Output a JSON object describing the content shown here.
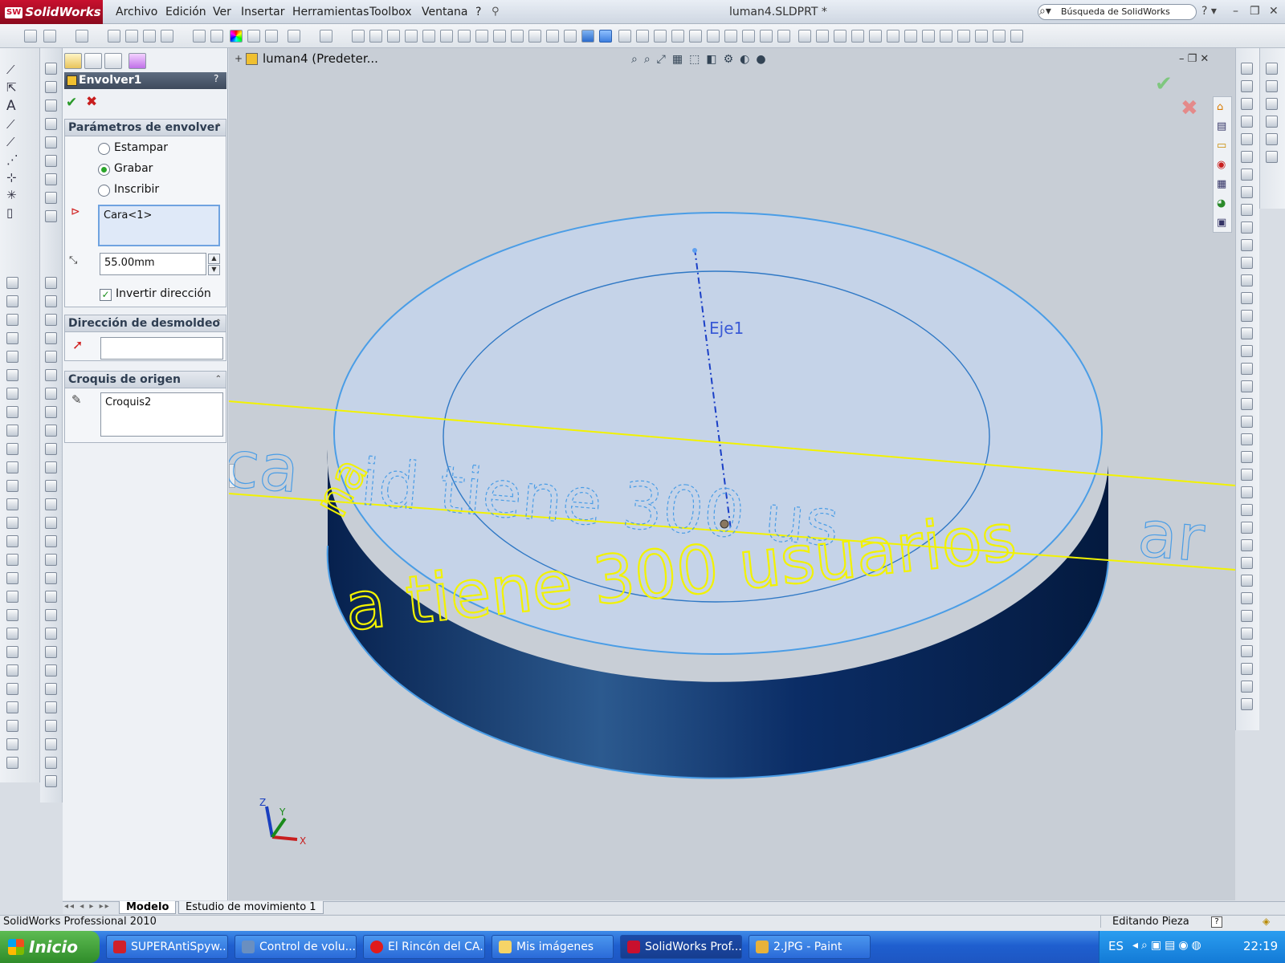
{
  "app": {
    "name": "SolidWorks",
    "logo_text": "SW"
  },
  "menu": [
    "Archivo",
    "Edición",
    "Ver",
    "Insertar",
    "Herramientas",
    "Toolbox",
    "Ventana",
    "?"
  ],
  "window": {
    "title": "luman4.SLDPRT *",
    "search_placeholder": "Búsqueda de SolidWorks"
  },
  "tree": {
    "label": "luman4  (Predeter..."
  },
  "property_manager": {
    "title": "Envolver1",
    "help": "?",
    "groups": {
      "params": {
        "title": "Parámetros de envolver",
        "options": [
          "Estampar",
          "Grabar",
          "Inscribir"
        ],
        "selected": "Grabar",
        "face": "Cara<1>",
        "depth": "55.00mm",
        "invert_label": "Invertir dirección",
        "invert_checked": true
      },
      "pull": {
        "title": "Dirección de desmoldeo",
        "value": ""
      },
      "source": {
        "title": "Croquis de origen",
        "value": "Croquis2"
      }
    }
  },
  "viewport": {
    "axis_label": "Eje1",
    "sketch_text_parts": [
      "ca",
      "id tiene 300 us",
      "ar"
    ],
    "wrap_text_parts": [
      "a tiene 300 usuarios",
      "na"
    ],
    "triad": {
      "z": "Z",
      "y": "Y",
      "x": "X"
    }
  },
  "bottom_tabs": [
    "Modelo",
    "Estudio de movimiento 1"
  ],
  "status": {
    "left": "SolidWorks Professional 2010",
    "right": "Editando Pieza",
    "help": "?"
  },
  "taskbar": {
    "start": "Inicio",
    "tasks": [
      "SUPERAntiSpyw...",
      "Control de volu...",
      "El Rincón del CA...",
      "Mis imágenes",
      "SolidWorks Prof...",
      "2.JPG - Paint"
    ],
    "lang": "ES",
    "time": "22:19"
  },
  "colors": {
    "accent": "#c8102e",
    "wrap_yellow": "#ffff00",
    "body_blue": "#0a2c66",
    "sketch_blue": "#3b8fe0",
    "start_green": "#2f8c2a"
  }
}
